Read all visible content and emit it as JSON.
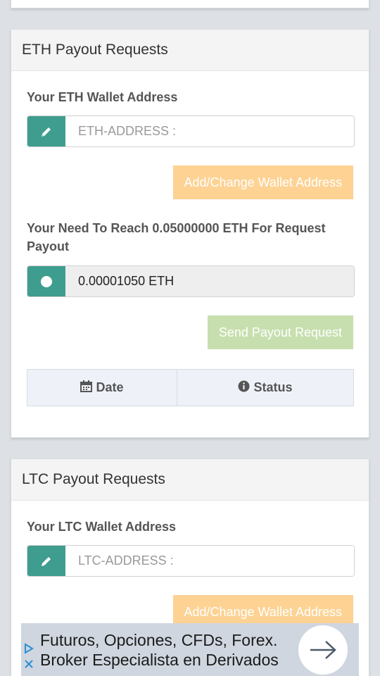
{
  "eth": {
    "title": "ETH Payout Requests",
    "wallet_label": "Your ETH Wallet Address",
    "wallet_placeholder": "ETH-ADDRESS :",
    "wallet_button": "Add/Change Wallet Address",
    "reach_text": "Your Need To Reach 0.05000000 ETH For Request Payout",
    "balance_value": "0.00001050 ETH",
    "send_button": "Send Payout Request",
    "table_headers": {
      "date": "Date",
      "status": "Status"
    }
  },
  "ltc": {
    "title": "LTC Payout Requests",
    "wallet_label": "Your LTC Wallet Address",
    "wallet_placeholder": "LTC-ADDRESS :",
    "wallet_button": "Add/Change Wallet Address"
  },
  "ad": {
    "line1": "Futuros, Opciones, CFDs, Forex.",
    "line2": "Broker Especialista en Derivados"
  },
  "icons": {
    "wallet": "pencil-icon",
    "balance": "circle-icon",
    "date": "calendar-icon",
    "status": "info-circle-icon",
    "ad_arrow": "arrow-right-icon",
    "ad_choices": "adchoices-icon",
    "ad_close": "close-icon"
  },
  "colors": {
    "accent": "#3f9d8f",
    "warning_button": "#fdd293",
    "success_button": "#c7dfae"
  }
}
